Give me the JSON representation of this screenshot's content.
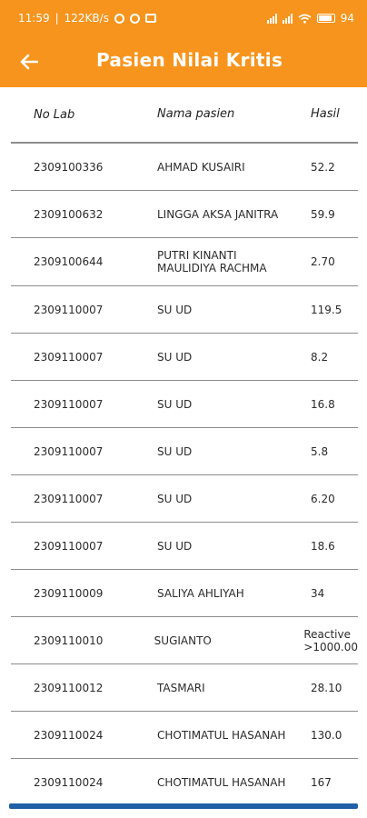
{
  "status": {
    "time": "11:59",
    "speed": "122KB/s",
    "battery": "94"
  },
  "header": {
    "title": "Pasien Nilai Kritis"
  },
  "table": {
    "columns": [
      "No Lab",
      "Nama pasien",
      "Hasil"
    ],
    "rows": [
      {
        "no_lab": "2309100336",
        "nama": "AHMAD KUSAIRI",
        "hasil": "52.2"
      },
      {
        "no_lab": "2309100632",
        "nama": "LINGGA AKSA JANITRA",
        "hasil": "59.9"
      },
      {
        "no_lab": "2309100644",
        "nama": "PUTRI KINANTI MAULIDIYA RACHMA",
        "hasil": "2.70"
      },
      {
        "no_lab": "2309110007",
        "nama": "SU UD",
        "hasil": "119.5"
      },
      {
        "no_lab": "2309110007",
        "nama": "SU UD",
        "hasil": "8.2"
      },
      {
        "no_lab": "2309110007",
        "nama": "SU UD",
        "hasil": "16.8"
      },
      {
        "no_lab": "2309110007",
        "nama": "SU UD",
        "hasil": "5.8"
      },
      {
        "no_lab": "2309110007",
        "nama": "SU UD",
        "hasil": "6.20"
      },
      {
        "no_lab": "2309110007",
        "nama": "SU UD",
        "hasil": "18.6"
      },
      {
        "no_lab": "2309110009",
        "nama": "SALIYA AHLIYAH",
        "hasil": "34"
      },
      {
        "no_lab": "2309110010",
        "nama": "SUGIANTO",
        "hasil": "Reactive >1000.00"
      },
      {
        "no_lab": "2309110012",
        "nama": "TASMARI",
        "hasil": "28.10"
      },
      {
        "no_lab": "2309110024",
        "nama": "CHOTIMATUL HASANAH",
        "hasil": "130.0"
      },
      {
        "no_lab": "2309110024",
        "nama": "CHOTIMATUL HASANAH",
        "hasil": "167"
      }
    ]
  },
  "colors": {
    "appbar": "#f7941d",
    "divider": "#8c8c8c",
    "nav_indicator": "#1f5fa8"
  },
  "icons": {
    "back": "arrow-left-icon"
  }
}
